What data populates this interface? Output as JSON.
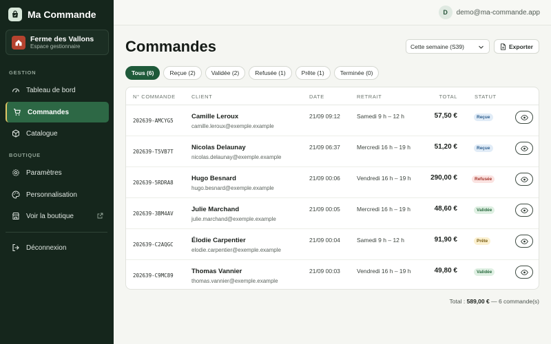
{
  "app": {
    "name": "Ma Commande"
  },
  "shop": {
    "name": "Ferme des Vallons",
    "subtitle": "Espace gestionnaire"
  },
  "sidebar": {
    "sections": [
      {
        "title": "GESTION"
      },
      {
        "title": "BOUTIQUE"
      }
    ],
    "items": [
      {
        "label": "Tableau de bord",
        "icon": "dashboard-icon"
      },
      {
        "label": "Commandes",
        "icon": "cart-icon",
        "active": true
      },
      {
        "label": "Catalogue",
        "icon": "box-icon"
      },
      {
        "label": "Paramètres",
        "icon": "gear-icon"
      },
      {
        "label": "Personnalisation",
        "icon": "palette-icon"
      },
      {
        "label": "Voir la boutique",
        "icon": "store-icon"
      },
      {
        "label": "Déconnexion",
        "icon": "logout-icon"
      }
    ]
  },
  "user": {
    "initial": "D",
    "email": "demo@ma-commande.app"
  },
  "page": {
    "title": "Commandes",
    "week_select": "Cette semaine (S39)",
    "export_label": "Exporter"
  },
  "filters": [
    {
      "label": "Tous (6)",
      "active": true
    },
    {
      "label": "Reçue (2)"
    },
    {
      "label": "Validée (2)"
    },
    {
      "label": "Refusée (1)"
    },
    {
      "label": "Prête (1)"
    },
    {
      "label": "Terminée (0)"
    }
  ],
  "table": {
    "headers": {
      "number": "N° COMMANDE",
      "client": "CLIENT",
      "date": "DATE",
      "pickup": "RETRAIT",
      "total": "TOTAL",
      "status": "STATUT"
    },
    "rows": [
      {
        "number": "202639-AMCYG5",
        "name": "Camille Leroux",
        "email": "camille.leroux@exemple.example",
        "date": "21/09 09:12",
        "pickup": "Samedi 9 h – 12 h",
        "total": "57,50 €",
        "status": "Reçue",
        "status_key": "recue"
      },
      {
        "number": "202639-T5VB7T",
        "name": "Nicolas Delaunay",
        "email": "nicolas.delaunay@exemple.example",
        "date": "21/09 06:37",
        "pickup": "Mercredi 16 h – 19 h",
        "total": "51,20 €",
        "status": "Reçue",
        "status_key": "recue"
      },
      {
        "number": "202639-5RDRA8",
        "name": "Hugo Besnard",
        "email": "hugo.besnard@exemple.example",
        "date": "21/09 00:06",
        "pickup": "Vendredi 16 h – 19 h",
        "total": "290,00 €",
        "status": "Refusée",
        "status_key": "refusee"
      },
      {
        "number": "202639-3BM4AV",
        "name": "Julie Marchand",
        "email": "julie.marchand@exemple.example",
        "date": "21/09 00:05",
        "pickup": "Mercredi 16 h – 19 h",
        "total": "48,60 €",
        "status": "Validée",
        "status_key": "validee"
      },
      {
        "number": "202639-C2AQGC",
        "name": "Élodie Carpentier",
        "email": "elodie.carpentier@exemple.example",
        "date": "21/09 00:04",
        "pickup": "Samedi 9 h – 12 h",
        "total": "91,90 €",
        "status": "Prête",
        "status_key": "prete"
      },
      {
        "number": "202639-C9MC89",
        "name": "Thomas Vannier",
        "email": "thomas.vannier@exemple.example",
        "date": "21/09 00:03",
        "pickup": "Vendredi 16 h – 19 h",
        "total": "49,80 €",
        "status": "Validée",
        "status_key": "validee"
      }
    ]
  },
  "status_colors": {
    "recue": {
      "bg": "#e1ecf7",
      "fg": "#2b5c8c"
    },
    "refusee": {
      "bg": "#fbe3e1",
      "fg": "#a2352b"
    },
    "validee": {
      "bg": "#dff0e3",
      "fg": "#2a6a3f"
    },
    "prete": {
      "bg": "#fbf0cf",
      "fg": "#7a5d14"
    }
  },
  "footer": {
    "prefix": "Total :",
    "amount": "589,00 €",
    "suffix": "— 6 commande(s)"
  }
}
